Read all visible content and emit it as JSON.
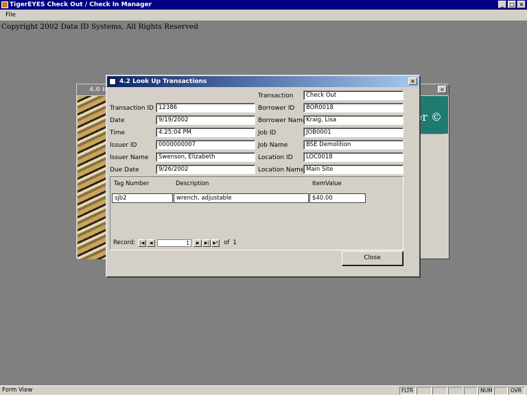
{
  "app": {
    "title": "TigerEYES Check Out / Check In Manager",
    "menu": [
      "File"
    ],
    "copyright": "Copyright 2002 Data ID Systems, All Rights Reserved",
    "window_buttons": [
      "_",
      "□",
      "×"
    ]
  },
  "background_window": {
    "title": "4.0 In",
    "brand_fragment": "er ©"
  },
  "dialog": {
    "title": "4.2 Look Up Transactions",
    "close_glyph": "×",
    "left_fields": [
      {
        "label": "Transaction ID",
        "value": "12386"
      },
      {
        "label": "Date",
        "value": "9/19/2002"
      },
      {
        "label": "Time",
        "value": "4:25:04 PM"
      },
      {
        "label": "Issuer ID",
        "value": "0000000007"
      },
      {
        "label": "Issuer Name",
        "value": "Swenson, Elizabeth"
      },
      {
        "label": "Due Date",
        "value": "9/26/2002"
      }
    ],
    "right_fields": [
      {
        "label": "Transaction",
        "value": "Check Out"
      },
      {
        "label": "Borrower ID",
        "value": "BOR0018"
      },
      {
        "label": "Borrower Name",
        "value": "Kraig, Lisa"
      },
      {
        "label": "Job ID",
        "value": "JOB0001"
      },
      {
        "label": "Job Name",
        "value": "BSE Demolition"
      },
      {
        "label": "Location ID",
        "value": "LOC0018"
      },
      {
        "label": "Location Name",
        "value": "Main Site"
      }
    ],
    "items_table": {
      "headers": [
        "Tag Number",
        "Description",
        "ItemValue"
      ],
      "rows": [
        [
          "sjb2",
          "wrench, adjustable",
          "$40.00"
        ]
      ]
    },
    "record_nav": {
      "label": "Record:",
      "current": "1",
      "of_label": "of",
      "total": "1",
      "buttons": [
        "|◀",
        "◀",
        "▶",
        "▶|",
        "▶*"
      ]
    },
    "close_button": "Close"
  },
  "status_bar": {
    "text": "Form View",
    "indicators": [
      "FLTR",
      "NUM",
      "OVR"
    ]
  }
}
